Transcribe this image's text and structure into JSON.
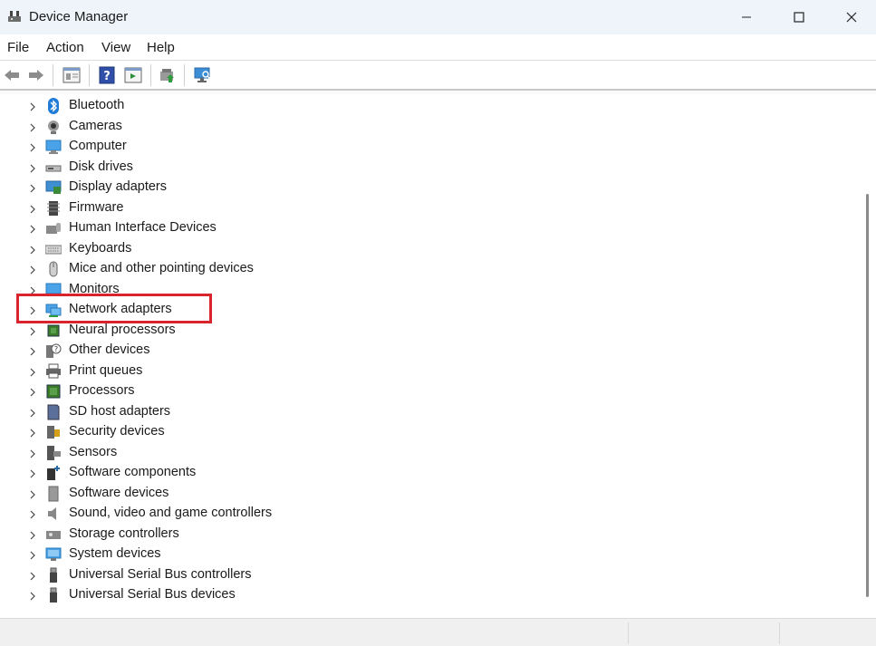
{
  "window": {
    "title": "Device Manager",
    "icon": "device-manager-icon",
    "controls": [
      "minimize",
      "maximize",
      "close"
    ]
  },
  "menu": [
    "File",
    "Action",
    "View",
    "Help"
  ],
  "toolbar": [
    "back-icon",
    "forward-icon",
    "properties-icon",
    "help-icon",
    "action-pane-icon",
    "update-driver-icon",
    "scan-hardware-icon"
  ],
  "tree": {
    "items": [
      {
        "label": "Bluetooth",
        "icon": "bluetooth-icon"
      },
      {
        "label": "Cameras",
        "icon": "camera-icon"
      },
      {
        "label": "Computer",
        "icon": "computer-icon"
      },
      {
        "label": "Disk drives",
        "icon": "disk-drive-icon"
      },
      {
        "label": "Display adapters",
        "icon": "display-adapter-icon"
      },
      {
        "label": "Firmware",
        "icon": "firmware-icon"
      },
      {
        "label": "Human Interface Devices",
        "icon": "hid-icon"
      },
      {
        "label": "Keyboards",
        "icon": "keyboard-icon"
      },
      {
        "label": "Mice and other pointing devices",
        "icon": "mouse-icon"
      },
      {
        "label": "Monitors",
        "icon": "monitor-icon"
      },
      {
        "label": "Network adapters",
        "icon": "network-adapter-icon"
      },
      {
        "label": "Neural processors",
        "icon": "chip-icon"
      },
      {
        "label": "Other devices",
        "icon": "unknown-device-icon"
      },
      {
        "label": "Print queues",
        "icon": "printer-icon"
      },
      {
        "label": "Processors",
        "icon": "processor-icon"
      },
      {
        "label": "SD host adapters",
        "icon": "sd-card-icon"
      },
      {
        "label": "Security devices",
        "icon": "security-device-icon"
      },
      {
        "label": "Sensors",
        "icon": "sensor-icon"
      },
      {
        "label": "Software components",
        "icon": "software-component-icon"
      },
      {
        "label": "Software devices",
        "icon": "software-device-icon"
      },
      {
        "label": "Sound, video and game controllers",
        "icon": "speaker-icon"
      },
      {
        "label": "Storage controllers",
        "icon": "storage-controller-icon"
      },
      {
        "label": "System devices",
        "icon": "system-device-icon"
      },
      {
        "label": "Universal Serial Bus controllers",
        "icon": "usb-icon"
      },
      {
        "label": "Universal Serial Bus devices",
        "icon": "usb-icon"
      }
    ]
  },
  "colors": {
    "highlight": "#d9232d",
    "titlebar": "#eef4f9"
  }
}
